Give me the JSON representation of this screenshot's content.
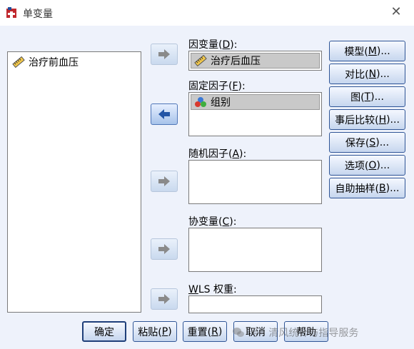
{
  "window": {
    "title": "单变量",
    "close_glyph": "✕"
  },
  "source_list": {
    "items": [
      {
        "label": "治疗前血压",
        "icon": "scale-ruler-icon"
      }
    ]
  },
  "fields": {
    "dependent": {
      "label_pre": "因变量(",
      "mnemonic": "D",
      "label_post": "):",
      "value": "治疗后血压",
      "icon": "scale-ruler-icon"
    },
    "fixed_factors": {
      "label_pre": "固定因子(",
      "mnemonic": "F",
      "label_post": "):",
      "items": [
        {
          "label": "组别",
          "icon": "nominal-balls-icon"
        }
      ]
    },
    "random_factors": {
      "label_pre": "随机因子(",
      "mnemonic": "A",
      "label_post": "):"
    },
    "covariates": {
      "label_pre": "协变量(",
      "mnemonic": "C",
      "label_post": "):"
    },
    "wls_weight": {
      "mnemonic": "W",
      "label_rest": "LS 权重:"
    }
  },
  "side_buttons": [
    {
      "pre": "模型(",
      "mnemonic": "M",
      "post": ")..."
    },
    {
      "pre": "对比(",
      "mnemonic": "N",
      "post": ")..."
    },
    {
      "pre": "图(",
      "mnemonic": "T",
      "post": ")..."
    },
    {
      "pre": "事后比较(",
      "mnemonic": "H",
      "post": ")..."
    },
    {
      "pre": "保存(",
      "mnemonic": "S",
      "post": ")..."
    },
    {
      "pre": "选项(",
      "mnemonic": "O",
      "post": ")..."
    },
    {
      "pre": "自助抽样(",
      "mnemonic": "B",
      "post": ")..."
    }
  ],
  "bottom_buttons": {
    "ok": "确定",
    "paste": {
      "pre": "粘贴(",
      "mnemonic": "P",
      "post": ")"
    },
    "reset": {
      "pre": "重置(",
      "mnemonic": "R",
      "post": ")"
    },
    "cancel": "取消",
    "help": "帮助"
  },
  "watermark": {
    "text": "号 · 清风统计与指导服务"
  },
  "colors": {
    "accent_border": "#2f5596",
    "client_bg": "#eef2fb",
    "selection": "#c9c9c9"
  }
}
